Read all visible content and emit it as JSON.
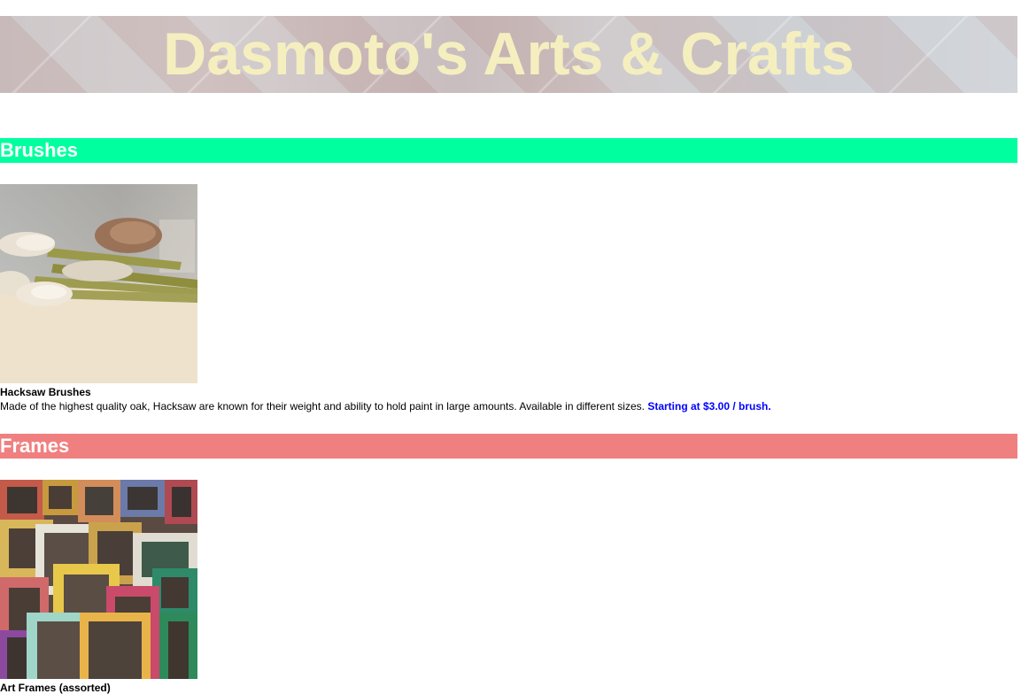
{
  "header": {
    "title": "Dasmoto's Arts & Crafts"
  },
  "sections": [
    {
      "heading": "Brushes",
      "heading_color": "#00ff9f",
      "product": {
        "image_alt": "paint brushes",
        "name": "Hacksaw Brushes",
        "description": "Made of the highest quality oak, Hacksaw are known for their weight and ability to hold paint in large amounts. Available in different sizes.",
        "price": "Starting at $3.00 / brush."
      }
    },
    {
      "heading": "Frames",
      "heading_color": "#f08080",
      "product": {
        "image_alt": "art frames",
        "name": "Art Frames (assorted)"
      }
    }
  ],
  "colors": {
    "title_text": "#f5efc0",
    "price_text": "#0000ff",
    "heading_text": "#ffffff"
  }
}
